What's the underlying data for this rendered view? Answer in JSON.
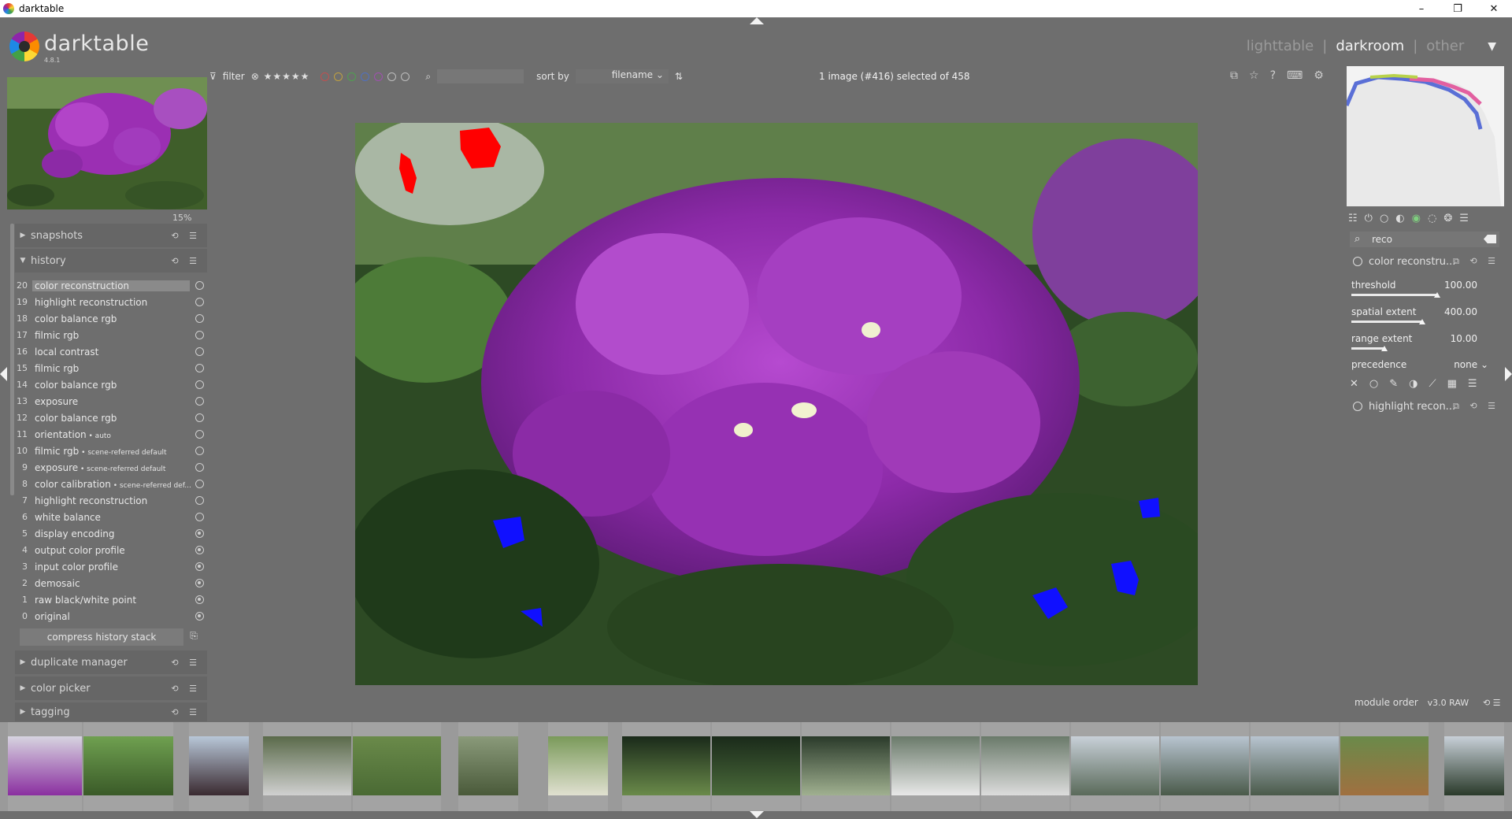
{
  "window": {
    "title": "darktable",
    "minimize": "–",
    "restore": "❐",
    "close": "✕"
  },
  "header": {
    "brand": "darktable",
    "version": "4.8.1",
    "views": [
      "lighttable",
      "darkroom",
      "other"
    ],
    "active_view": "darkroom",
    "separator": "|"
  },
  "toolbar": {
    "filter_label": "filter",
    "stars": "⊗ ★★★★★",
    "sort_label": "sort by",
    "sort_value": "filename",
    "selection_info": "1 image (#416) selected of 458",
    "color_labels": [
      "#c05050",
      "#c0a040",
      "#50a050",
      "#5070c0",
      "#a050b0",
      "#bdbdbd",
      "#bdbdbd"
    ]
  },
  "left_panel": {
    "zoom": "15%",
    "sections": {
      "snapshots": "snapshots",
      "history": "history",
      "duplicate_manager": "duplicate manager",
      "color_picker": "color picker",
      "tagging": "tagging"
    },
    "history": [
      {
        "num": "20",
        "label": "color reconstruction",
        "suffix": "",
        "selected": true,
        "dot": false
      },
      {
        "num": "19",
        "label": "highlight reconstruction",
        "suffix": "",
        "dot": false
      },
      {
        "num": "18",
        "label": "color balance rgb",
        "suffix": "",
        "dot": false
      },
      {
        "num": "17",
        "label": "filmic rgb",
        "suffix": "",
        "dot": false
      },
      {
        "num": "16",
        "label": "local contrast",
        "suffix": "",
        "dot": false
      },
      {
        "num": "15",
        "label": "filmic rgb",
        "suffix": "",
        "dot": false
      },
      {
        "num": "14",
        "label": "color balance rgb",
        "suffix": "",
        "dot": false
      },
      {
        "num": "13",
        "label": "exposure",
        "suffix": "",
        "dot": false
      },
      {
        "num": "12",
        "label": "color balance rgb",
        "suffix": "",
        "dot": false
      },
      {
        "num": "11",
        "label": "orientation",
        "suffix": " • auto",
        "dot": false
      },
      {
        "num": "10",
        "label": "filmic rgb",
        "suffix": " • scene-referred default",
        "dot": false
      },
      {
        "num": "9",
        "label": "exposure",
        "suffix": " • scene-referred default",
        "dot": false
      },
      {
        "num": "8",
        "label": "color calibration",
        "suffix": " • scene-referred def...",
        "dot": false
      },
      {
        "num": "7",
        "label": "highlight reconstruction",
        "suffix": "",
        "dot": false
      },
      {
        "num": "6",
        "label": "white balance",
        "suffix": "",
        "dot": false
      },
      {
        "num": "5",
        "label": "display encoding",
        "suffix": "",
        "dot": true
      },
      {
        "num": "4",
        "label": "output color profile",
        "suffix": "",
        "dot": true
      },
      {
        "num": "3",
        "label": "input color profile",
        "suffix": "",
        "dot": true
      },
      {
        "num": "2",
        "label": "demosaic",
        "suffix": "",
        "dot": true
      },
      {
        "num": "1",
        "label": "raw black/white point",
        "suffix": "",
        "dot": true
      },
      {
        "num": "0",
        "label": "original",
        "suffix": "",
        "dot": true
      }
    ],
    "compress_button": "compress history stack"
  },
  "right_panel": {
    "search_value": "reco",
    "module1": "color reconstru...",
    "module2": "highlight recon...",
    "params": [
      {
        "name": "threshold",
        "value": "100.00",
        "level": 0.68
      },
      {
        "name": "spatial extent",
        "value": "400.00",
        "level": 0.56
      },
      {
        "name": "range extent",
        "value": "10.00",
        "level": 0.26
      }
    ],
    "precedence_label": "precedence",
    "precedence_value": "none",
    "module_order_label": "module order",
    "module_order_value": "v3.0 RAW"
  }
}
